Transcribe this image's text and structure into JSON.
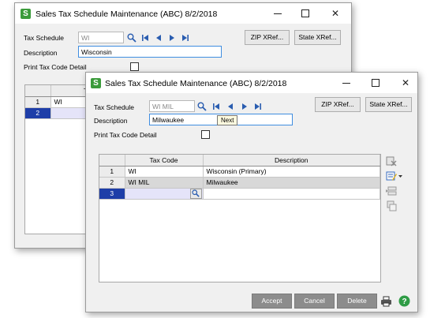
{
  "back_window": {
    "app_icon": "S",
    "title": "Sales Tax Schedule Maintenance (ABC) 8/2/2018",
    "tax_schedule_label": "Tax Schedule",
    "tax_schedule_value": "WI",
    "description_label": "Description",
    "description_value": "Wisconsin",
    "print_detail_label": "Print Tax Code Detail",
    "zip_button": "ZIP XRef...",
    "state_button": "State XRef...",
    "grid_header_partial": "Ta",
    "rows": [
      {
        "num": "1",
        "code": "WI"
      },
      {
        "num": "2",
        "code": ""
      }
    ]
  },
  "front_window": {
    "app_icon": "S",
    "title": "Sales Tax Schedule Maintenance (ABC) 8/2/2018",
    "tax_schedule_label": "Tax Schedule",
    "tax_schedule_value": "WI MIL",
    "description_label": "Description",
    "description_value": "Milwaukee",
    "print_detail_label": "Print Tax Code Detail",
    "tooltip": "Next",
    "zip_button": "ZIP XRef...",
    "state_button": "State XRef...",
    "grid": {
      "columns": [
        "Tax Code",
        "Description"
      ],
      "rows": [
        {
          "num": "1",
          "code": "WI",
          "description": "Wisconsin (Primary)"
        },
        {
          "num": "2",
          "code": "WI MIL",
          "description": "Milwaukee"
        },
        {
          "num": "3",
          "code": "",
          "description": ""
        }
      ]
    },
    "buttons": {
      "accept": "Accept",
      "cancel": "Cancel",
      "delete": "Delete"
    }
  },
  "icons": {
    "lookup": "magnifier-icon",
    "nav_first": "first-record-icon",
    "nav_prev": "previous-record-icon",
    "nav_next": "next-record-icon",
    "nav_last": "last-record-icon",
    "print": "printer-icon",
    "help": "help-icon"
  },
  "colors": {
    "accent_blue": "#1e3ea8",
    "app_green": "#3b9b3b",
    "focus_border": "#3f8de0"
  }
}
